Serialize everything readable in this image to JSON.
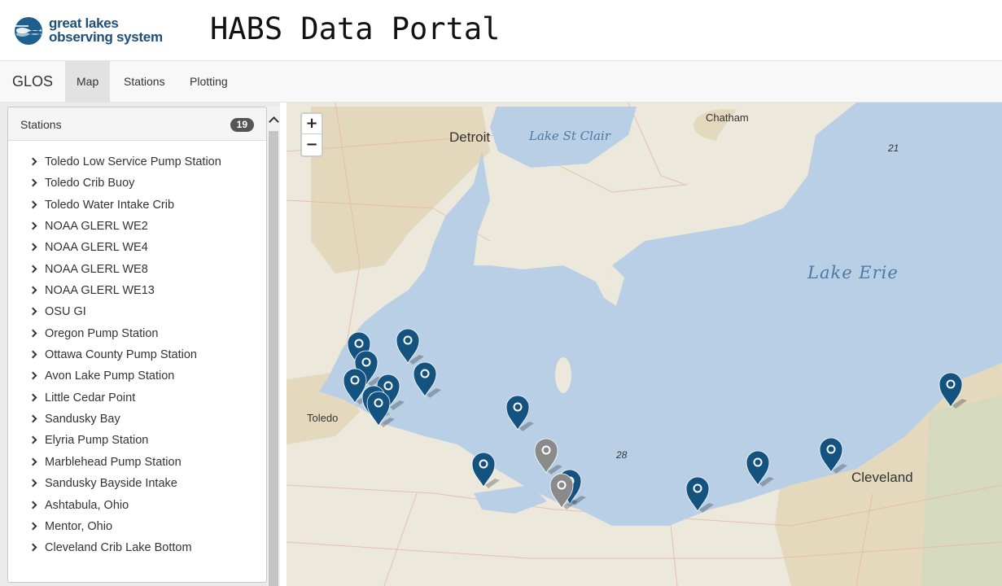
{
  "header": {
    "logo_line1": "great lakes",
    "logo_line2": "observing system",
    "title": "HABS Data Portal"
  },
  "navbar": {
    "brand": "GLOS",
    "items": [
      {
        "label": "Map",
        "active": true
      },
      {
        "label": "Stations",
        "active": false
      },
      {
        "label": "Plotting",
        "active": false
      }
    ]
  },
  "sidebar": {
    "panel_title": "Stations",
    "count": "19",
    "stations": [
      "Toledo Low Service Pump Station",
      "Toledo Crib Buoy",
      "Toledo Water Intake Crib",
      "NOAA GLERL WE2",
      "NOAA GLERL WE4",
      "NOAA GLERL WE8",
      "NOAA GLERL WE13",
      "OSU GI",
      "Oregon Pump Station",
      "Ottawa County Pump Station",
      "Avon Lake Pump Station",
      "Little Cedar Point",
      "Sandusky Bay",
      "Elyria Pump Station",
      "Marblehead Pump Station",
      "Sandusky Bayside Intake",
      "Ashtabula, Ohio",
      "Mentor, Ohio",
      "Cleveland Crib Lake Bottom"
    ]
  },
  "map": {
    "zoom_in": "+",
    "zoom_out": "−",
    "labels": {
      "detroit": "Detroit",
      "lake_st_clair": "Lake St Clair",
      "chatham": "Chatham",
      "lake_erie": "Lake Erie",
      "toledo": "Toledo",
      "cleveland": "Cleveland",
      "depth_21": "21",
      "depth_28": "28"
    },
    "colors": {
      "water": "#b8cfe5",
      "land": "#ece8dc",
      "urban": "#e2d5b5",
      "marker_active": "#14537f",
      "marker_inactive": "#8a8a8a"
    }
  }
}
